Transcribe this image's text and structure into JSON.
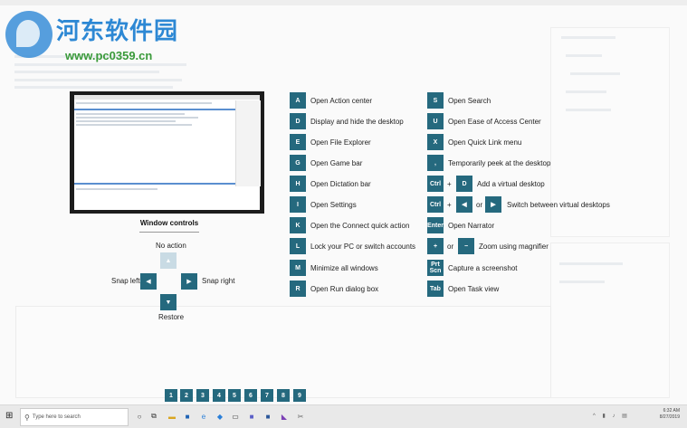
{
  "watermark": {
    "title": "河东软件园",
    "url": "www.pc0359.cn"
  },
  "window_controls": {
    "title": "Window controls",
    "no_action": "No action",
    "snap_left": "Snap left",
    "snap_right": "Snap right",
    "restore": "Restore",
    "arrows": {
      "up": "▲",
      "left": "◀",
      "right": "▶",
      "down": "▼"
    }
  },
  "shortcuts_left": [
    {
      "key": "A",
      "desc": "Open Action center"
    },
    {
      "key": "D",
      "desc": "Display and hide the desktop"
    },
    {
      "key": "E",
      "desc": "Open File Explorer"
    },
    {
      "key": "G",
      "desc": "Open Game bar"
    },
    {
      "key": "H",
      "desc": "Open Dictation bar"
    },
    {
      "key": "I",
      "desc": "Open Settings"
    },
    {
      "key": "K",
      "desc": "Open the Connect quick action"
    },
    {
      "key": "L",
      "desc": "Lock your PC or switch accounts"
    },
    {
      "key": "M",
      "desc": "Minimize all windows"
    },
    {
      "key": "R",
      "desc": "Open Run dialog box"
    }
  ],
  "shortcuts_right": {
    "s": {
      "key": "S",
      "desc": "Open Search"
    },
    "u": {
      "key": "U",
      "desc": "Open Ease of Access Center"
    },
    "x": {
      "key": "X",
      "desc": "Open Quick Link menu"
    },
    "comma": {
      "key": ",",
      "desc": "Temporarily peek at the desktop"
    },
    "ctrl_d": {
      "key1": "Ctrl",
      "plus": "+",
      "key2": "D",
      "desc": "Add a virtual desktop"
    },
    "ctrl_arrows": {
      "key1": "Ctrl",
      "plus": "+",
      "key2": "◀",
      "or": "or",
      "key3": "▶",
      "desc": "Switch between virtual desktops"
    },
    "enter": {
      "key": "Enter",
      "desc": "Open Narrator"
    },
    "zoom": {
      "key1": "+",
      "or": "or",
      "key2": "−",
      "desc": "Zoom using magnifier"
    },
    "prtscn": {
      "key_line1": "Prt",
      "key_line2": "Scn",
      "desc": "Capture a screenshot"
    },
    "tab": {
      "key": "Tab",
      "desc": "Open Task view"
    }
  },
  "taskbar": {
    "search_placeholder": "Type here to search",
    "numbers": [
      "1",
      "2",
      "3",
      "4",
      "5",
      "6",
      "7",
      "8",
      "9"
    ],
    "time": "6:32 AM",
    "date": "8/27/2019"
  },
  "colors": {
    "key_bg": "#25697e",
    "key_faded": "#c9dbe4"
  }
}
